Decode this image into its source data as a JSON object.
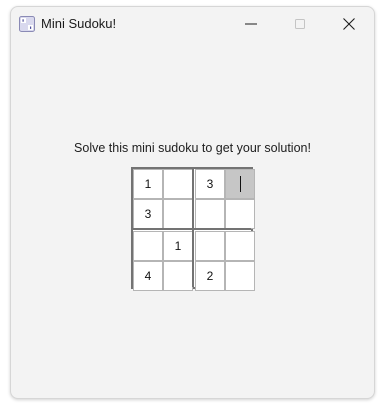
{
  "window": {
    "title": "Mini Sudoku!",
    "icon": "sudoku-app-icon",
    "controls": [
      "minimize-icon",
      "maximize-icon",
      "close-icon"
    ]
  },
  "prompt": "Solve this mini sudoku to get your solution!",
  "sudoku": {
    "size": 4,
    "rows": [
      [
        "1",
        "",
        "3",
        ""
      ],
      [
        "3",
        "",
        "",
        ""
      ],
      [
        "",
        "1",
        "",
        ""
      ],
      [
        "4",
        "",
        "2",
        ""
      ]
    ],
    "active_cell": {
      "row": 0,
      "col": 3
    }
  },
  "colors": {
    "window_bg": "#f3f3f3",
    "grid_border": "#737373",
    "cell_border": "#b5b5b5",
    "active_cell": "#c6c6c6"
  }
}
